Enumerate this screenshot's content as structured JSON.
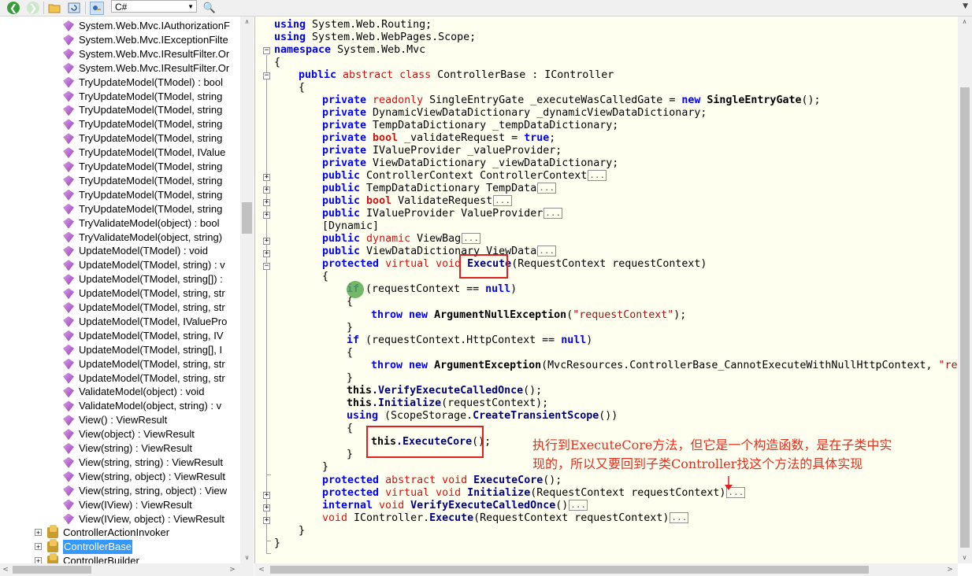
{
  "toolbar": {
    "back_icon": "back-arrow-icon",
    "forward_icon": "forward-arrow-icon",
    "open_icon": "open-folder-icon",
    "refresh_icon": "refresh-icon",
    "browse_icon": "browse-icon",
    "language": "C#",
    "search_icon": "search-icon"
  },
  "tree": {
    "members": [
      "System.Web.Mvc.IAuthorizationF",
      "System.Web.Mvc.IExceptionFilte",
      "System.Web.Mvc.IResultFilter.Or",
      "System.Web.Mvc.IResultFilter.Or",
      "TryUpdateModel(TModel) : bool",
      "TryUpdateModel(TModel, string",
      "TryUpdateModel(TModel, string",
      "TryUpdateModel(TModel, string",
      "TryUpdateModel(TModel, string",
      "TryUpdateModel(TModel, IValue",
      "TryUpdateModel(TModel, string",
      "TryUpdateModel(TModel, string",
      "TryUpdateModel(TModel, string",
      "TryUpdateModel(TModel, string",
      "TryValidateModel(object) : bool",
      "TryValidateModel(object, string)",
      "UpdateModel(TModel) : void",
      "UpdateModel(TModel, string) : v",
      "UpdateModel(TModel, string[]) :",
      "UpdateModel(TModel, string, str",
      "UpdateModel(TModel, string, str",
      "UpdateModel(TModel, IValuePro",
      "UpdateModel(TModel, string, IV",
      "UpdateModel(TModel, string[], I",
      "UpdateModel(TModel, string, str",
      "UpdateModel(TModel, string, str",
      "ValidateModel(object) : void",
      "ValidateModel(object, string) : v",
      "View() : ViewResult",
      "View(object) : ViewResult",
      "View(string) : ViewResult",
      "View(string, string) : ViewResult",
      "View(string, object) : ViewResult",
      "View(string, string, object) : View",
      "View(IView) : ViewResult",
      "View(IView, object) : ViewResult"
    ],
    "classes": [
      "ControllerActionInvoker",
      "ControllerBase",
      "ControllerBuilder"
    ],
    "selected_class": "ControllerBase"
  },
  "code": {
    "l1_kw": "using",
    "l1_rest": " System.Web.Routing;",
    "l2_kw": "using",
    "l2_rest": " System.Web.WebPages.Scope;",
    "l3_kw": "namespace",
    "l3_rest": " System.Web.Mvc",
    "l4": "{",
    "l5_kw1": "public",
    "l5_kw2": " abstract class",
    "l5_rest": " ControllerBase : IController",
    "l6": "{",
    "l7_kw1": "private",
    "l7_kw2": " readonly",
    "l7_a": " SingleEntryGate _executeWasCalledGate = ",
    "l7_new": "new",
    "l7_cls": " SingleEntryGate",
    "l7_end": "();",
    "l8_kw": "private",
    "l8_rest": " DynamicViewDataDictionary _dynamicViewDataDictionary;",
    "l9_kw": "private",
    "l9_rest": " TempDataDictionary _tempDataDictionary;",
    "l10_kw": "private",
    "l10_bool": " bool",
    "l10_a": " _validateRequest = ",
    "l10_true": "true",
    "l10_end": ";",
    "l11_kw": "private",
    "l11_rest": " IValueProvider _valueProvider;",
    "l12_kw": "private",
    "l12_rest": " ViewDataDictionary _viewDataDictionary;",
    "l13_kw": "public",
    "l13_rest": " ControllerContext ControllerContext",
    "l14_kw": "public",
    "l14_rest": " TempDataDictionary TempData",
    "l15_kw": "public",
    "l15_bool": " bool",
    "l15_rest": " ValidateRequest",
    "l16_kw": "public",
    "l16_rest": " IValueProvider ValueProvider",
    "l17": "[Dynamic]",
    "l18_kw": "public",
    "l18_dyn": " dynamic",
    "l18_rest": " ViewBag",
    "l19_kw": "public",
    "l19_rest": " ViewDataDictionary ViewData",
    "l20_kw1": "protected",
    "l20_kw2": " virtual void",
    "l20_mth": " Execute",
    "l20_rest": "(RequestContext requestContext)",
    "l21": "{",
    "l22_kw": "if",
    "l22_a": " (requestContext == ",
    "l22_null": "null",
    "l22_end": ")",
    "l23": "{",
    "l24_kw1": "throw",
    "l24_kw2": " new",
    "l24_cls": " ArgumentNullException",
    "l24_a": "(",
    "l24_str": "\"requestContext\"",
    "l24_end": ");",
    "l25": "}",
    "l26_kw": "if",
    "l26_a": " (requestContext.HttpContext == ",
    "l26_null": "null",
    "l26_end": ")",
    "l27": "{",
    "l28_kw1": "throw",
    "l28_kw2": " new",
    "l28_cls": " ArgumentException",
    "l28_a": "(MvcResources.ControllerBase_CannotExecuteWithNullHttpContext, ",
    "l28_str": "\"request",
    "l29": "}",
    "l30_this": "this",
    "l30_mth": ".VerifyExecuteCalledOnce",
    "l30_end": "();",
    "l31_this": "this",
    "l31_mth": ".Initialize",
    "l31_end": "(requestContext);",
    "l32_kw": "using",
    "l32_a": " (ScopeStorage.",
    "l32_mth": "CreateTransientScope",
    "l32_end": "())",
    "l33": "{",
    "l34_this": "this",
    "l34_mth": ".ExecuteCore",
    "l34_end": "();",
    "l35": "}",
    "l36": "}",
    "l37_kw1": "protected",
    "l37_kw2": " abstract void",
    "l37_mth": " ExecuteCore",
    "l37_end": "();",
    "l38_kw1": "protected",
    "l38_kw2": " virtual void",
    "l38_mth": " Initialize",
    "l38_rest": "(RequestContext requestContext)",
    "l39_kw1": "internal",
    "l39_kw2": " void",
    "l39_mth": " VerifyExecuteCalledOnce",
    "l39_end": "()",
    "l40_kw": "void",
    "l40_a": " IController.",
    "l40_mth": "Execute",
    "l40_rest": "(RequestContext requestContext)",
    "l41": "}",
    "l42": "}",
    "ellipsis": "..."
  },
  "annotation": {
    "line1": "执行到ExecuteCore方法，但它是一个构造函数，是在子类中实",
    "line2": "现的，所以又要回到子类Controller找这个方法的具体实现"
  }
}
